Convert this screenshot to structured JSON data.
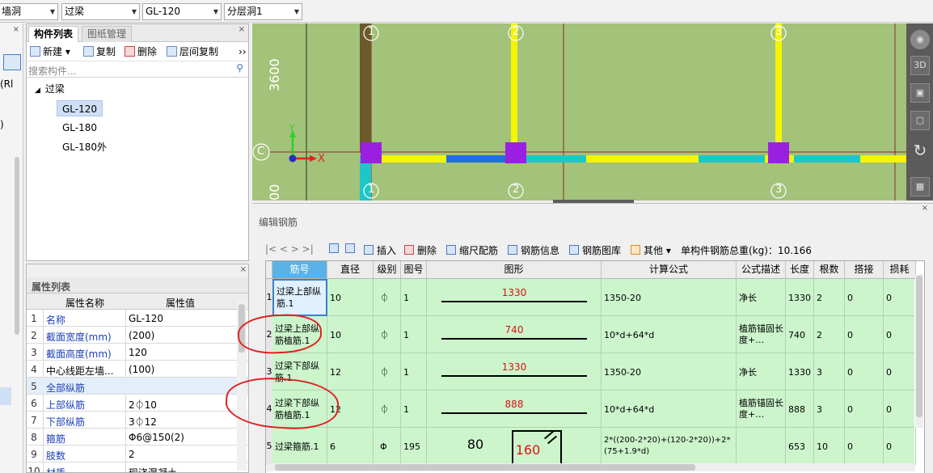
{
  "topbar": {
    "combos": [
      {
        "value": "墙洞"
      },
      {
        "value": "过梁"
      },
      {
        "value": "GL-120"
      },
      {
        "value": "分层洞1"
      }
    ]
  },
  "left_strip": {
    "items": [
      "(Rl",
      ")"
    ]
  },
  "component_panel": {
    "tabs": {
      "active": "构件列表",
      "inactive": "图纸管理"
    },
    "toolbar": {
      "new": "新建",
      "copy": "复制",
      "delete": "删除",
      "floor_copy": "层间复制",
      "more": "››"
    },
    "search_placeholder": "搜索构件...",
    "tree": {
      "root": "过梁",
      "items": [
        {
          "label": "GL-120",
          "selected": true
        },
        {
          "label": "GL-180",
          "selected": false
        },
        {
          "label": "GL-180外",
          "selected": false
        }
      ]
    }
  },
  "property_panel": {
    "title": "属性列表",
    "headers": {
      "name": "属性名称",
      "value": "属性值"
    },
    "rows": [
      {
        "num": "1",
        "name": "名称",
        "value": "GL-120",
        "blue": true
      },
      {
        "num": "2",
        "name": "截面宽度(mm)",
        "value": "(200)",
        "blue": true
      },
      {
        "num": "3",
        "name": "截面高度(mm)",
        "value": "120",
        "blue": true
      },
      {
        "num": "4",
        "name": "中心线距左墙...",
        "value": "(100)",
        "blue": false
      },
      {
        "num": "5",
        "name": "全部纵筋",
        "value": "",
        "blue": true
      },
      {
        "num": "6",
        "name": "上部纵筋",
        "value": "2⏀10",
        "blue": true
      },
      {
        "num": "7",
        "name": "下部纵筋",
        "value": "3⏀12",
        "blue": true
      },
      {
        "num": "8",
        "name": "箍筋",
        "value": "Φ6@150(2)",
        "blue": true
      },
      {
        "num": "9",
        "name": "肢数",
        "value": "2",
        "blue": true
      },
      {
        "num": "10",
        "name": "材质",
        "value": "现浇混凝土",
        "blue": true
      }
    ]
  },
  "viewport": {
    "axis_labels_top": [
      "1",
      "2",
      "3"
    ],
    "axis_labels_bottom": [
      "1",
      "2",
      "3"
    ],
    "axis_left": "C",
    "dim_left_top": "3600",
    "dim_left_bottom": "00",
    "coord_x": "X",
    "coord_y": "Y",
    "tools": [
      "globe-icon",
      "3d-view-icon",
      "cube-top-icon",
      "cube-side-icon",
      "rotate-icon",
      "grid-view-icon"
    ],
    "tool_3d_label": "3D"
  },
  "editor": {
    "title": "编辑钢筋",
    "toolbar": {
      "nav": "|<  <  >  >|",
      "insert": "插入",
      "delete": "删除",
      "scale": "缩尺配筋",
      "info": "钢筋信息",
      "library": "钢筋图库",
      "other": "其他",
      "total_label": "单构件钢筋总重(kg)：10.166"
    },
    "columns": [
      "筋号",
      "直径(mm)",
      "级别",
      "图号",
      "图形",
      "计算公式",
      "公式描述",
      "长度",
      "根数",
      "搭接",
      "损耗"
    ],
    "rows": [
      {
        "num": "1",
        "name": "过梁上部纵筋.1",
        "dia": "10",
        "grade": "⏀",
        "fig": "1",
        "shape_val": "1330",
        "formula": "1350-20",
        "desc": "净长",
        "length": "1330",
        "count": "2",
        "lap": "0",
        "loss": "0"
      },
      {
        "num": "2",
        "name": "过梁上部纵筋植筋.1",
        "dia": "10",
        "grade": "⏀",
        "fig": "1",
        "shape_val": "740",
        "formula": "10*d+64*d",
        "desc": "植筋锚固长度+…",
        "length": "740",
        "count": "2",
        "lap": "0",
        "loss": "0"
      },
      {
        "num": "3",
        "name": "过梁下部纵筋.1",
        "dia": "12",
        "grade": "⏀",
        "fig": "1",
        "shape_val": "1330",
        "formula": "1350-20",
        "desc": "净长",
        "length": "1330",
        "count": "3",
        "lap": "0",
        "loss": "0"
      },
      {
        "num": "4",
        "name": "过梁下部纵筋植筋.1",
        "dia": "12",
        "grade": "⏀",
        "fig": "1",
        "shape_val": "888",
        "formula": "10*d+64*d",
        "desc": "植筋锚固长度+…",
        "length": "888",
        "count": "3",
        "lap": "0",
        "loss": "0"
      },
      {
        "num": "5",
        "name": "过梁箍筋.1",
        "dia": "6",
        "grade": "Φ",
        "fig": "195",
        "shape_val": "160",
        "shape_left": "80",
        "formula": "2*((200-2*20)+(120-2*20))+2*(75+1.9*d)",
        "desc": "",
        "length": "653",
        "count": "10",
        "lap": "0",
        "loss": "0"
      }
    ]
  },
  "colors": {
    "viewport_bg": "#a3c27a",
    "selected_header": "#5bb2e6",
    "row_green": "#ccf5cc",
    "annotation_red": "#e02020",
    "shape_red": "#d11111"
  }
}
